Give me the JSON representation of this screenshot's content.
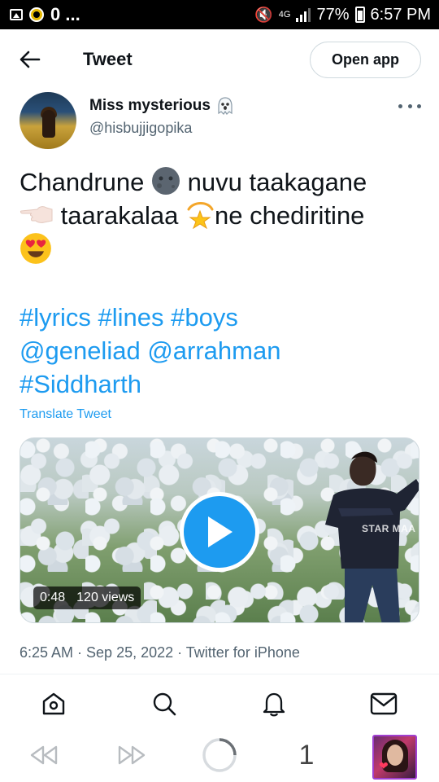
{
  "status_bar": {
    "left_text": "0 ...",
    "network": "4G",
    "battery_percent": "77%",
    "time": "6:57 PM"
  },
  "header": {
    "title": "Tweet",
    "open_app_label": "Open app"
  },
  "tweet": {
    "author": {
      "display_name": "Miss mysterious",
      "username": "@hisbujjigopika",
      "badge_icon": "ghost-icon"
    },
    "text_parts": [
      "Chandrune",
      "nuvu taakagane",
      "taarakalaa",
      "ne chediritine"
    ],
    "emojis": [
      "new-moon-face-icon",
      "pointing-left-icon",
      "dizzy-star-icon",
      "heart-eyes-icon"
    ],
    "hashtags_line1": [
      "#lyrics",
      "#lines",
      "#boys"
    ],
    "mentions_line2": [
      "@geneliad",
      "@arrahman"
    ],
    "hashtags_line3": [
      "#Siddharth"
    ],
    "translate_label": "Translate Tweet",
    "video": {
      "duration": "0:48",
      "views": "120 views",
      "watermark": "STAR MAA"
    },
    "timestamp": "6:25 AM · Sep 25, 2022 · Twitter for iPhone"
  },
  "bottom_tabs": [
    "home-icon",
    "search-icon",
    "notifications-bell-icon",
    "messages-envelope-icon"
  ],
  "browser_nav": {
    "tab_count": "1"
  },
  "colors": {
    "accent": "#1d9bf0",
    "text": "#0f1419",
    "secondary": "#536471"
  }
}
